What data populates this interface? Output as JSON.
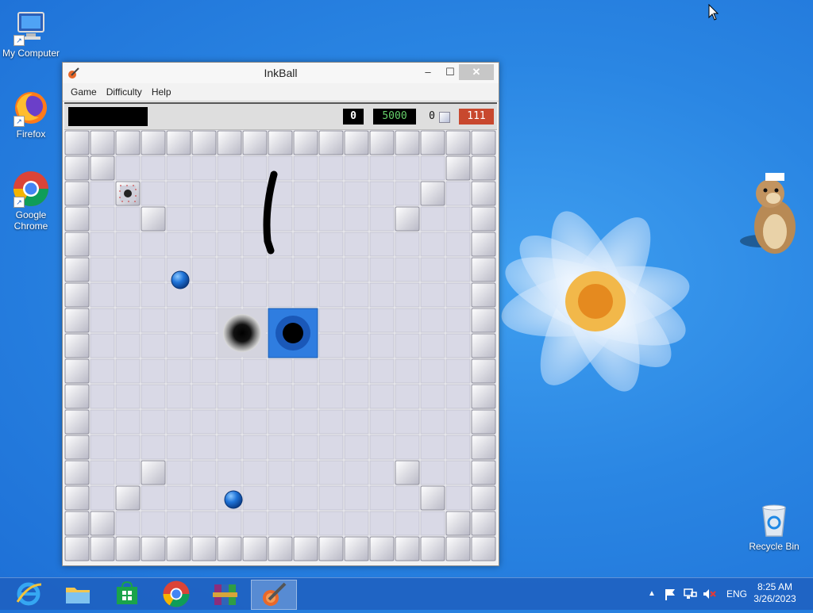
{
  "desktop": {
    "icons": [
      {
        "label": "My Computer"
      },
      {
        "label": "Firefox"
      },
      {
        "label": "Google Chrome"
      },
      {
        "label": "Recycle Bin"
      }
    ]
  },
  "window": {
    "title": "InkBall",
    "controls": {
      "minimize": "–",
      "maximize": "☐",
      "close": "✕"
    },
    "menu": [
      {
        "label": "Game"
      },
      {
        "label": "Difficulty"
      },
      {
        "label": "Help"
      }
    ],
    "hud": {
      "score": "0",
      "target": "5000",
      "balls_count": "0",
      "timer": "111"
    }
  },
  "taskbar": {
    "apps": [
      "internet-explorer",
      "file-explorer",
      "store",
      "chrome",
      "winrar",
      "inkball"
    ],
    "tray": {
      "language": "ENG"
    },
    "clock": {
      "time": "8:25 AM",
      "date": "3/26/2023"
    }
  },
  "colors": {
    "desktop_bg": "#2a86e3",
    "tile": "#d9d9e6",
    "ball_blue": "#1f73d8",
    "hud_timer": "#c8482e",
    "hud_target_text": "#66d06a"
  }
}
